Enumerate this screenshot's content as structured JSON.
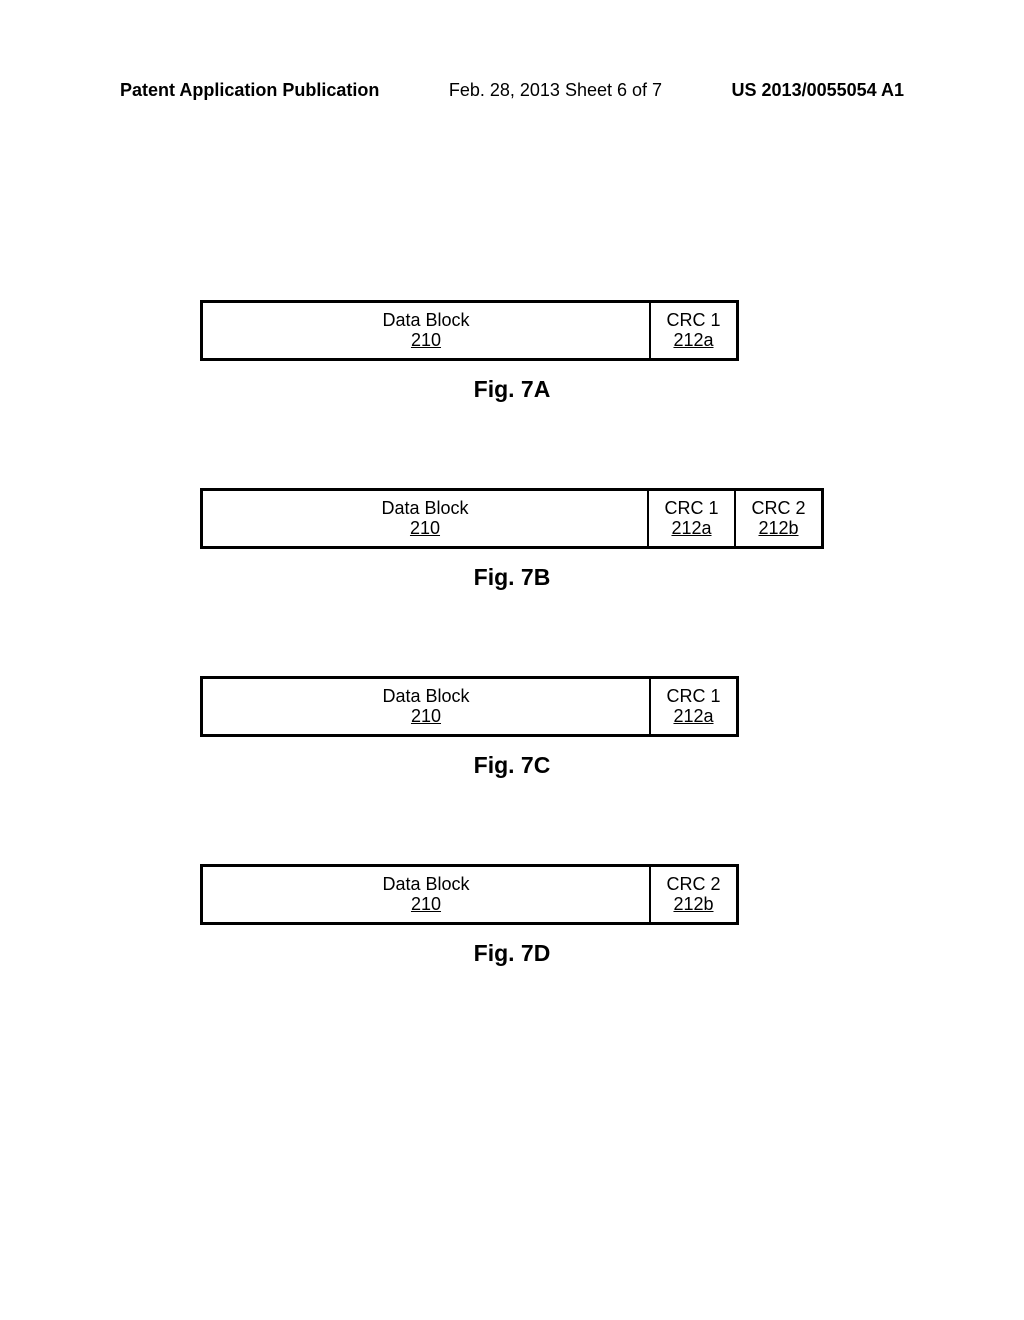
{
  "header": {
    "left": "Patent Application Publication",
    "center": "Feb. 28, 2013  Sheet 6 of 7",
    "right": "US 2013/0055054 A1"
  },
  "figures": {
    "fig7a": {
      "label": "Fig. 7A",
      "data_block_label": "Data Block",
      "data_block_ref": "210",
      "crc1_label": "CRC 1",
      "crc1_ref": "212a"
    },
    "fig7b": {
      "label": "Fig. 7B",
      "data_block_label": "Data Block",
      "data_block_ref": "210",
      "crc1_label": "CRC 1",
      "crc1_ref": "212a",
      "crc2_label": "CRC 2",
      "crc2_ref": "212b"
    },
    "fig7c": {
      "label": "Fig. 7C",
      "data_block_label": "Data Block",
      "data_block_ref": "210",
      "crc1_label": "CRC 1",
      "crc1_ref": "212a"
    },
    "fig7d": {
      "label": "Fig. 7D",
      "data_block_label": "Data Block",
      "data_block_ref": "210",
      "crc2_label": "CRC 2",
      "crc2_ref": "212b"
    }
  }
}
